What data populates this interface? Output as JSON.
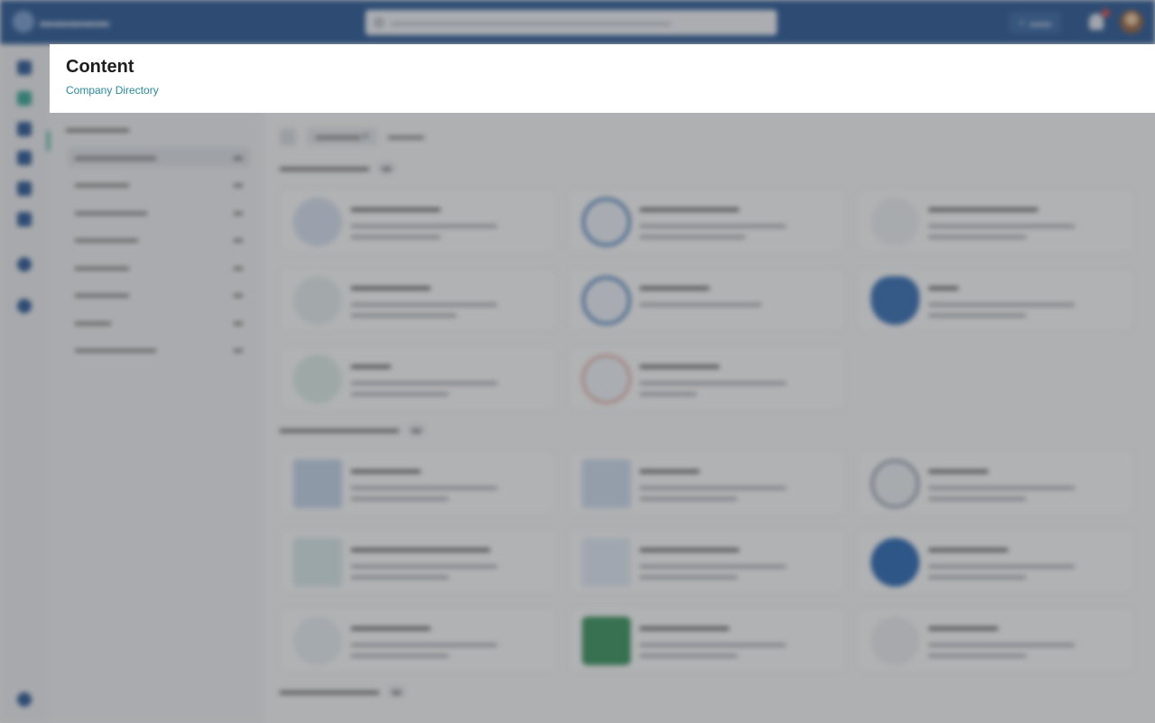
{
  "header": {
    "title": "Content",
    "breadcrumb": "Company Directory"
  }
}
